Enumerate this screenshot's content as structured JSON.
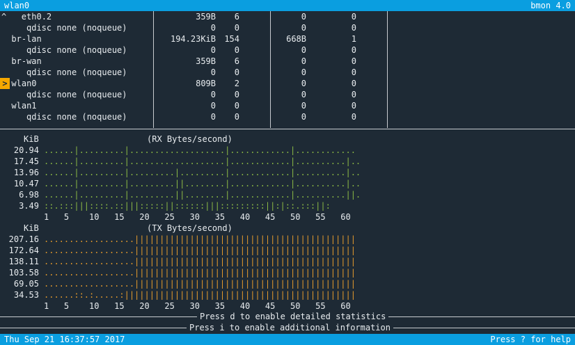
{
  "title_bar": {
    "left": "wlan0",
    "right": "bmon 4.0"
  },
  "interfaces": [
    {
      "indent": "^   ",
      "name": "eth0.2",
      "rx_bytes": "359B",
      "rx_packets": "6",
      "tx_bytes": "0",
      "tx_packets": "0"
    },
    {
      "indent": "     ",
      "name": "qdisc none (noqueue)",
      "rx_bytes": "0",
      "rx_packets": "0",
      "tx_bytes": "0",
      "tx_packets": "0"
    },
    {
      "indent": "  ",
      "name": "br-lan",
      "rx_bytes": "194.23KiB",
      "rx_packets": "154",
      "tx_bytes": "668B",
      "tx_packets": "1"
    },
    {
      "indent": "     ",
      "name": "qdisc none (noqueue)",
      "rx_bytes": "0",
      "rx_packets": "0",
      "tx_bytes": "0",
      "tx_packets": "0"
    },
    {
      "indent": "  ",
      "name": "br-wan",
      "rx_bytes": "359B",
      "rx_packets": "6",
      "tx_bytes": "0",
      "tx_packets": "0"
    },
    {
      "indent": "     ",
      "name": "qdisc none (noqueue)",
      "rx_bytes": "0",
      "rx_packets": "0",
      "tx_bytes": "0",
      "tx_packets": "0"
    },
    {
      "indent": "  ",
      "name": "wlan0",
      "rx_bytes": "809B",
      "rx_packets": "2",
      "tx_bytes": "0",
      "tx_packets": "0",
      "selected": true
    },
    {
      "indent": "     ",
      "name": "qdisc none (noqueue)",
      "rx_bytes": "0",
      "rx_packets": "0",
      "tx_bytes": "0",
      "tx_packets": "0"
    },
    {
      "indent": "  ",
      "name": "wlan1",
      "rx_bytes": "0",
      "rx_packets": "0",
      "tx_bytes": "0",
      "tx_packets": "0"
    },
    {
      "indent": "     ",
      "name": "qdisc none (noqueue)",
      "rx_bytes": "0",
      "rx_packets": "0",
      "tx_bytes": "0",
      "tx_packets": "0"
    }
  ],
  "selection_marker": ">",
  "rx_graph": {
    "unit": "KiB",
    "title": "(RX Bytes/second)",
    "rows": [
      {
        "label": "20.94",
        "text": "......|.........|...................|............|............"
      },
      {
        "label": "17.45",
        "text": "......|.........|...................|............|..........|.."
      },
      {
        "label": "13.96",
        "text": "......|.........|.........|.........|............|..........|.."
      },
      {
        "label": "10.47",
        "text": "......|.........|.........||........|............|..........|.."
      },
      {
        "label": "6.98",
        "text": "......|.........|.........||........|............|..........||."
      },
      {
        "label": "3.49",
        "text": "::.:::|||::::.::|||:::::||::::::|||:::::::::||:|::.:::||:"
      }
    ],
    "x_axis": "1   5    10   15   20   25   30   35   40   45   50   55   60"
  },
  "tx_graph": {
    "unit": "KiB",
    "title": "(TX Bytes/second)",
    "rows": [
      {
        "label": "207.16",
        "text": "..................||||||||||||||||||||||||||||||||||||||||||||"
      },
      {
        "label": "172.64",
        "text": "..................||||||||||||||||||||||||||||||||||||||||||||"
      },
      {
        "label": "138.11",
        "text": "..................||||||||||||||||||||||||||||||||||||||||||||"
      },
      {
        "label": "103.58",
        "text": "..................||||||||||||||||||||||||||||||||||||||||||||"
      },
      {
        "label": "69.05",
        "text": "..................||||||||||||||||||||||||||||||||||||||||||||"
      },
      {
        "label": "34.53",
        "text": "......::.:.....:||||||||||||||||||||||||||||||||||||||||||||||"
      }
    ],
    "x_axis": "1   5    10   15   20   25   30   35   40   45   50   55   60"
  },
  "hints": {
    "detailed": "Press d to enable detailed statistics",
    "additional": "Press i to enable additional information"
  },
  "status_bar": {
    "timestamp": "Thu Sep 21 16:37:57 2017",
    "help": "Press ? for help"
  },
  "colors": {
    "bar": "#0a9ee0",
    "background": "#1e2a35",
    "rx": "#8ab845",
    "tx": "#e39a2c",
    "selection": "#f5a700"
  }
}
